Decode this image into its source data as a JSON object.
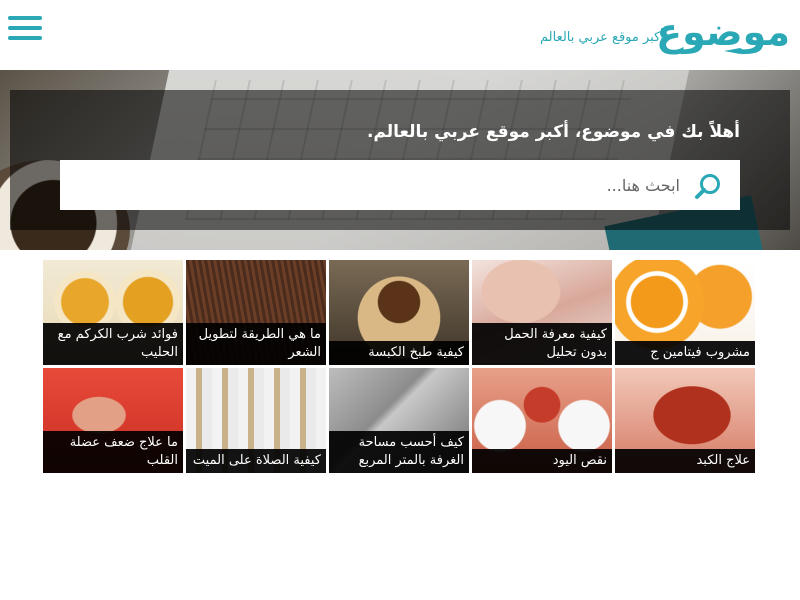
{
  "header": {
    "logo_text": "موضوع",
    "tagline": "أكبر موقع عربي بالعالم",
    "menu_icon": "hamburger-menu-icon",
    "accent_color": "#2aa8b5"
  },
  "hero": {
    "welcome": "أهلاً بك في موضوع، أكبر موقع عربي بالعالم.",
    "search_placeholder": "ابحث هنا...",
    "search_icon": "search-icon"
  },
  "articles": [
    {
      "title": "مشروب فيتامين ج"
    },
    {
      "title": "كيفية معرفة الحمل بدون تحليل"
    },
    {
      "title": "كيفية طبخ الكبسة"
    },
    {
      "title": "ما هي الطريقة لتطويل الشعر"
    },
    {
      "title": "فوائد شرب الكركم مع الحليب"
    },
    {
      "title": "علاج الكبد"
    },
    {
      "title": "نقص اليود"
    },
    {
      "title": "كيف أحسب مساحة الغرفة بالمتر المربع"
    },
    {
      "title": "كيفية الصلاة على الميت"
    },
    {
      "title": "ما علاج ضعف عضلة القلب"
    }
  ]
}
